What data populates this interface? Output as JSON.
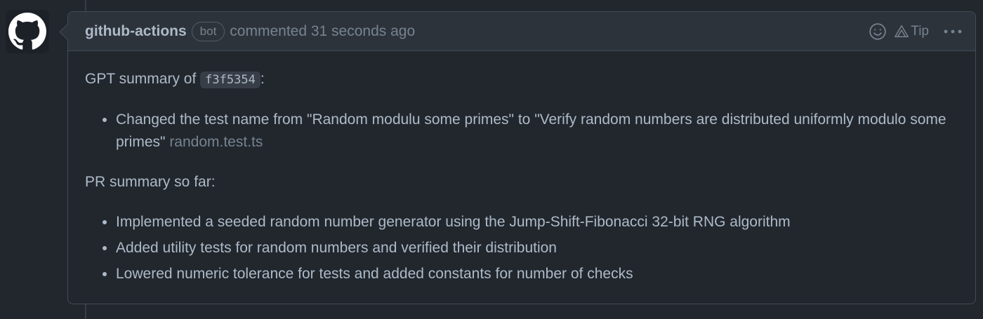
{
  "comment": {
    "author": "github-actions",
    "badge": "bot",
    "meta": "commented 31 seconds ago",
    "actions": {
      "emoji_icon": "smiley-icon",
      "tip_label": "Tip",
      "tip_icon": "alert-triangle-icon",
      "more_icon": "kebab-horizontal-icon"
    },
    "body": {
      "gpt_summary_prefix": "GPT summary of ",
      "commit_sha": "f3f5354",
      "gpt_summary_suffix": ":",
      "commit_changes": [
        {
          "text": "Changed the test name from \"Random modulu some primes\" to \"Verify random numbers are distributed uniformly modulo some primes\"",
          "file": "random.test.ts"
        }
      ],
      "pr_summary_heading": "PR summary so far:",
      "pr_changes": [
        "Implemented a seeded random number generator using the Jump-Shift-Fibonacci 32-bit RNG algorithm",
        "Added utility tests for random numbers and verified their distribution",
        "Lowered numeric tolerance for tests and added constants for number of checks"
      ]
    }
  },
  "colors": {
    "background": "#22272e",
    "header_bg": "#2d333b",
    "border": "#444c56",
    "text": "#adbac7",
    "muted": "#768390"
  }
}
